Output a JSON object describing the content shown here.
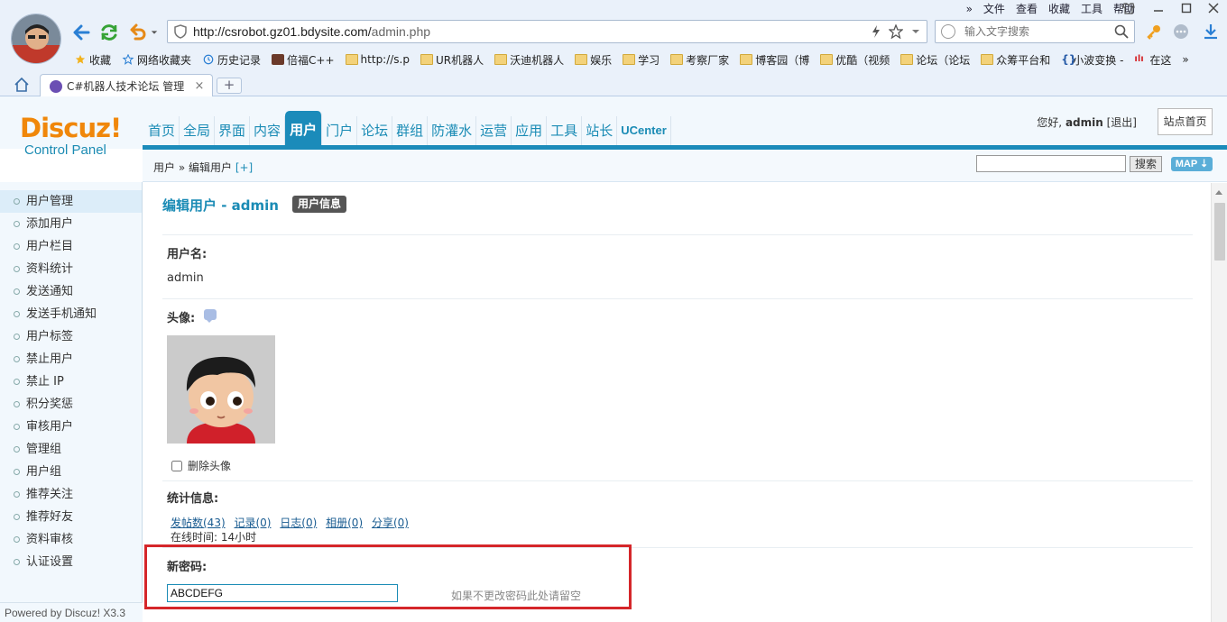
{
  "browser": {
    "url_host": "http://csrobot.gz01.bdysite.com/",
    "url_path": "admin.php",
    "search_placeholder": "输入文字搜索",
    "menu": [
      "»",
      "文件",
      "查看",
      "收藏",
      "工具",
      "帮助"
    ],
    "bookmarks": [
      "收藏",
      "网络收藏夹",
      "历史记录",
      "倍福C++",
      "http://s.p",
      "UR机器人",
      "沃迪机器人",
      "娱乐",
      "学习",
      "考察厂家",
      "博客园（博",
      "优酷（视频",
      "论坛（论坛",
      "众筹平台和",
      "小波变换 -",
      "在这",
      "»"
    ],
    "tab_title": "C#机器人技术论坛 管理",
    "tab_close": "×",
    "tab_new": "+"
  },
  "header": {
    "logo_main": "Discuz!",
    "logo_sub": "Control Panel",
    "nav": [
      "首页",
      "全局",
      "界面",
      "内容",
      "用户",
      "门户",
      "论坛",
      "群组",
      "防灌水",
      "运营",
      "应用",
      "工具",
      "站长",
      "UCenter"
    ],
    "active_nav": "用户",
    "greeting": "您好,",
    "username": "admin",
    "logout": "[退出]",
    "site_home": "站点首页"
  },
  "crumb": {
    "path": "用户 » 编辑用户",
    "plus": "[+]",
    "search_button": "搜索",
    "map_button": "MAP ⇣"
  },
  "sidebar": {
    "items": [
      "用户管理",
      "添加用户",
      "用户栏目",
      "资料统计",
      "发送通知",
      "发送手机通知",
      "用户标签",
      "禁止用户",
      "禁止 IP",
      "积分奖惩",
      "审核用户",
      "管理组",
      "用户组",
      "推荐关注",
      "推荐好友",
      "资料审核",
      "认证设置"
    ],
    "active": "用户管理",
    "powered": "Powered by Discuz! X3.3"
  },
  "main": {
    "title": "编辑用户 - admin",
    "badge": "用户信息",
    "username_label": "用户名:",
    "username_value": "admin",
    "avatar_label": "头像:",
    "delete_avatar": "删除头像",
    "stats_label": "统计信息:",
    "stat_links": [
      "发帖数(43)",
      "记录(0)",
      "日志(0)",
      "相册(0)",
      "分享(0)"
    ],
    "online_time": "在线时间: 14小时",
    "new_password_label": "新密码:",
    "new_password_value": "ABCDEFG",
    "password_hint": "如果不更改密码此处请留空"
  },
  "colors": {
    "accent": "#1b8bba",
    "logo_orange": "#f0870a",
    "highlight_red": "#d5262a"
  }
}
